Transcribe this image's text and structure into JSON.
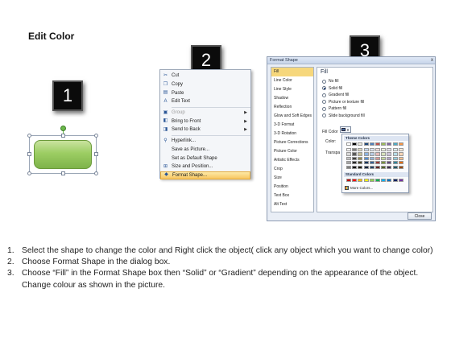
{
  "slide": {
    "title": "Edit Color"
  },
  "steps": [
    "1",
    "2",
    "3"
  ],
  "context_menu": {
    "items": [
      {
        "label": "Cut",
        "icon": "scissors-icon",
        "glyph": "✂",
        "disabled": false
      },
      {
        "label": "Copy",
        "icon": "copy-icon",
        "glyph": "❐",
        "disabled": false
      },
      {
        "label": "Paste",
        "icon": "paste-icon",
        "glyph": "▤",
        "disabled": false
      },
      {
        "label": "Edit Text",
        "icon": "edit-text-icon",
        "glyph": "A",
        "disabled": false,
        "separator_after": true
      },
      {
        "label": "Group",
        "icon": "group-icon",
        "glyph": "▣",
        "disabled": true,
        "submenu": true
      },
      {
        "label": "Bring to Front",
        "icon": "bring-front-icon",
        "glyph": "◧",
        "disabled": false,
        "submenu": true
      },
      {
        "label": "Send to Back",
        "icon": "send-back-icon",
        "glyph": "◨",
        "disabled": false,
        "submenu": true,
        "separator_after": true
      },
      {
        "label": "Hyperlink...",
        "icon": "hyperlink-icon",
        "glyph": "⚲",
        "disabled": false
      },
      {
        "label": "Save as Picture...",
        "icon": "",
        "glyph": "",
        "disabled": false
      },
      {
        "label": "Set as Default Shape",
        "icon": "",
        "glyph": "",
        "disabled": false
      },
      {
        "label": "Size and Position...",
        "icon": "size-position-icon",
        "glyph": "⊞",
        "disabled": false
      },
      {
        "label": "Format Shape...",
        "icon": "format-shape-icon",
        "glyph": "◆",
        "disabled": false,
        "highlighted": true
      }
    ]
  },
  "dialog": {
    "title": "Format Shape",
    "close_glyph": "x",
    "nav": [
      "Fill",
      "Line Color",
      "Line Style",
      "Shadow",
      "Reflection",
      "Glow and Soft Edges",
      "3-D Format",
      "3-D Rotation",
      "Picture Corrections",
      "Picture Color",
      "Artistic Effects",
      "Crop",
      "Size",
      "Position",
      "Text Box",
      "Alt Text"
    ],
    "active_nav": "Fill",
    "panel_heading": "Fill",
    "options": [
      {
        "label": "No fill",
        "checked": false
      },
      {
        "label": "Solid fill",
        "checked": true
      },
      {
        "label": "Gradient fill",
        "checked": false
      },
      {
        "label": "Picture or texture fill",
        "checked": false
      },
      {
        "label": "Pattern fill",
        "checked": false
      },
      {
        "label": "Slide background fill",
        "checked": false
      }
    ],
    "fill_color_heading": "Fill Color",
    "color_label": "Color:",
    "transparency_label": "Transpa",
    "close_button": "Close"
  },
  "color_dropdown": {
    "theme_heading": "Theme Colors",
    "standard_heading": "Standard Colors",
    "more_colors": "More Colors...",
    "theme_top": [
      "#ffffff",
      "#000000",
      "#eeece1",
      "#1f497d",
      "#4f81bd",
      "#c0504d",
      "#9bbb59",
      "#8064a2",
      "#4bacc6",
      "#f79646"
    ],
    "theme_tints": [
      [
        "#f2f2f2",
        "#7f7f7f",
        "#ddd9c3",
        "#c6d9f0",
        "#dbe5f1",
        "#f2dcdb",
        "#ebf1dd",
        "#e5e0ec",
        "#dbeef3",
        "#fdeada"
      ],
      [
        "#d8d8d8",
        "#595959",
        "#c4bd97",
        "#8db3e2",
        "#b8cce4",
        "#e5b9b7",
        "#d7e3bc",
        "#ccc1d9",
        "#b7dde8",
        "#fbd5b5"
      ],
      [
        "#bfbfbf",
        "#3f3f3f",
        "#938953",
        "#548dd4",
        "#95b3d7",
        "#d99694",
        "#c3d69b",
        "#b2a2c7",
        "#92cddc",
        "#fac08f"
      ],
      [
        "#a5a5a5",
        "#262626",
        "#494429",
        "#17365d",
        "#366092",
        "#953734",
        "#76923c",
        "#5f497a",
        "#31859b",
        "#e36c09"
      ],
      [
        "#7f7f7f",
        "#0c0c0c",
        "#1d1b10",
        "#0f243e",
        "#244061",
        "#632423",
        "#4f6128",
        "#3f3151",
        "#205867",
        "#974806"
      ]
    ],
    "standard": [
      "#c00000",
      "#ff0000",
      "#ffc000",
      "#ffff00",
      "#92d050",
      "#00b050",
      "#00b0f0",
      "#0070c0",
      "#002060",
      "#7030a0"
    ]
  },
  "instructions": [
    {
      "num": "1.",
      "text": "Select the shape to change the color and Right click the object( click any object which you want to change color)"
    },
    {
      "num": "2.",
      "text": "Choose Format Shape in the dialog box."
    },
    {
      "num": "3.",
      "text": "Choose “Fill” in the Format Shape box then “Solid” or “Gradient” depending on the appearance of the object. Change colour as shown in the picture."
    }
  ]
}
